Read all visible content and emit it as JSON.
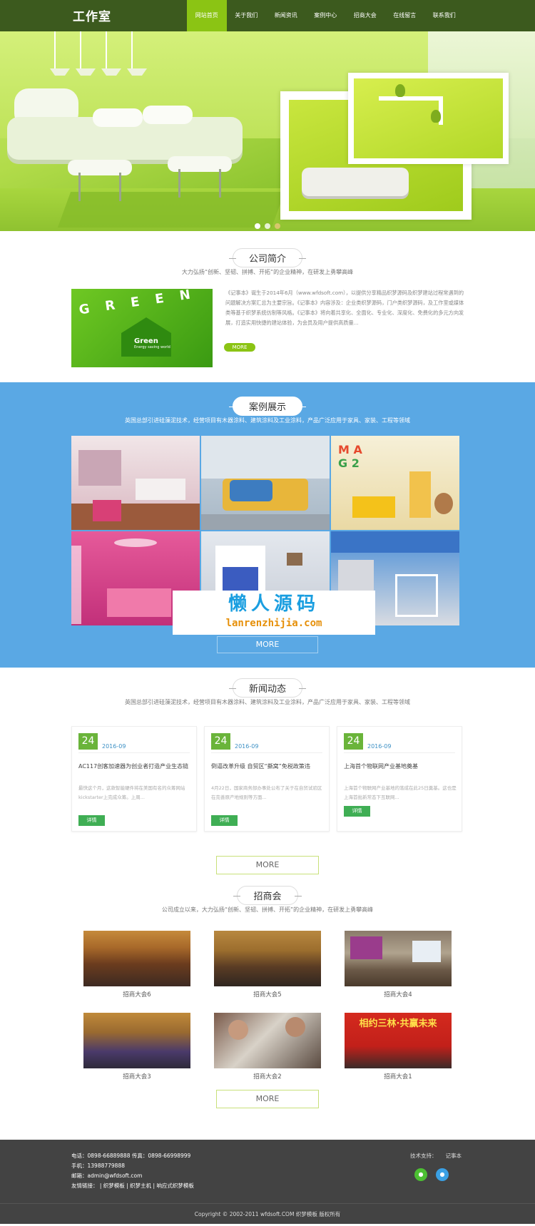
{
  "header": {
    "logo": "工作室",
    "nav": [
      "网站首页",
      "关于我们",
      "新闻资讯",
      "案例中心",
      "招商大会",
      "在线留言",
      "联系我们"
    ]
  },
  "banner": {
    "slide_count": 3,
    "active_slide": 1
  },
  "about": {
    "title": "公司简介",
    "subtitle": "大力弘扬“创新、坚韧、拼搏、开拓”的企业精神，在研发上勇攀高峰",
    "image_text": "Green",
    "image_letters": "G R E E N",
    "image_caption": "Energy saving world",
    "body": "《记事本》诞生于2014年6月（www.wfdsoft.com），以提供分享精品织梦源码及织梦建站过程常遇到的问题解决方案汇总为主要宗旨。《记事本》内容涉及：企业类织梦源码，门户类织梦源码，及工作室或媒体类等基于织梦系统仿制等风格。《记事本》将向着共享化、全面化、专业化、深度化、免费化的多元方向发展，打造实用快捷的建站体验，为会员及用户提供高质量...",
    "more": "MORE"
  },
  "cases": {
    "title": "案例展示",
    "subtitle": "英国总部引进硅藻泥技术，经营项目有木器涂料、建筑涂料及工业涂料，产品广泛应用于家具、家装、工程等领域",
    "watermark_cn": "懒人源码",
    "watermark_en": "lanrenzhijia.com",
    "more": "MORE"
  },
  "news": {
    "title": "新闻动态",
    "subtitle": "英国总部引进硅藻泥技术，经营项目有木器涂料、建筑涂料及工业涂料，产品广泛应用于家具、家装、工程等领域",
    "items": [
      {
        "day": "24",
        "month": "2016-09",
        "title": "AC117创客加速器为创业者打造产业生态链",
        "desc": "最快这个月，这款智能硬件将在美国有名的众筹网站kickstarter上完成众筹。上周...",
        "btn": "详情"
      },
      {
        "day": "24",
        "month": "2016-09",
        "title": "倒逼改革升级 自贸区“撕窝”免税政策违",
        "desc": "4月22日，国家商务部办事处公布了关于在自贸试验区在完善原产地规则等方面...",
        "btn": "详情"
      },
      {
        "day": "24",
        "month": "2016-09",
        "title": "上海首个物联网产业基地奠基",
        "desc": "上海首个物联网产业基地的落成在此25日奠基。这也是上海首批新常态下互联网...",
        "btn": "详情"
      }
    ],
    "more": "MORE"
  },
  "invest": {
    "title": "招商会",
    "subtitle": "公司成立以来，大力弘扬“创新、坚韧、拼搏、开拓”的企业精神，在研发上勇攀高峰",
    "items": [
      "招商大会6",
      "招商大会5",
      "招商大会4",
      "招商大会3",
      "招商大会2",
      "招商大会1"
    ],
    "banner_text": "相约三林·共赢未来",
    "more": "MORE"
  },
  "footer": {
    "phone": "电话：0898-66889888 传真：0898-66998999",
    "mobile": "手机：13988779888",
    "email": "邮箱：admin@wfdsoft.com",
    "links_label": "友情链接：",
    "links": [
      "织梦模板",
      "织梦主机",
      "响应式织梦模板"
    ],
    "tech_label": "技术支持：",
    "tech_value": "记事本",
    "copyright": "Copyright © 2002-2011 wfdsoft.COM 织梦模板 版权所有"
  }
}
